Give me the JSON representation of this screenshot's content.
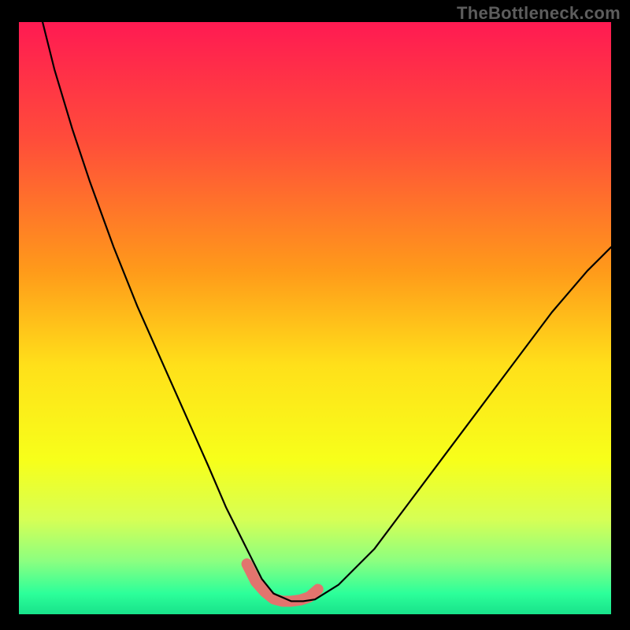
{
  "watermark": "TheBottleneck.com",
  "chart_data": {
    "type": "line",
    "title": "",
    "xlabel": "",
    "ylabel": "",
    "xlim": [
      0,
      100
    ],
    "ylim": [
      0,
      100
    ],
    "gradient_stops": [
      {
        "offset": 0.0,
        "color": "#ff1a52"
      },
      {
        "offset": 0.2,
        "color": "#ff4d3a"
      },
      {
        "offset": 0.42,
        "color": "#ff9a1a"
      },
      {
        "offset": 0.58,
        "color": "#ffe01a"
      },
      {
        "offset": 0.74,
        "color": "#f7ff1a"
      },
      {
        "offset": 0.84,
        "color": "#d6ff55"
      },
      {
        "offset": 0.91,
        "color": "#8cff80"
      },
      {
        "offset": 0.965,
        "color": "#2cff9a"
      },
      {
        "offset": 1.0,
        "color": "#18e28a"
      }
    ],
    "series": [
      {
        "name": "bottleneck-curve",
        "stroke": "#000000",
        "stroke_width": 2.2,
        "x": [
          4,
          6,
          9,
          12,
          16,
          20,
          24,
          28,
          32,
          35,
          37.5,
          39.5,
          41,
          43,
          46,
          48,
          50,
          54,
          60,
          66,
          72,
          78,
          84,
          90,
          96,
          100
        ],
        "y": [
          100,
          92,
          82,
          73,
          62,
          52,
          43,
          34,
          25,
          18,
          13,
          9,
          6,
          3.5,
          2.2,
          2.2,
          2.5,
          5,
          11,
          19,
          27,
          35,
          43,
          51,
          58,
          62
        ]
      }
    ],
    "highlight": {
      "name": "valley-highlight",
      "stroke": "#e2746e",
      "stroke_width": 14,
      "x": [
        38.5,
        40,
        41.5,
        43,
        44.5,
        46,
        47.5,
        49,
        50.5
      ],
      "y": [
        8.5,
        5.5,
        3.8,
        2.6,
        2.2,
        2.2,
        2.4,
        2.9,
        4.2
      ]
    }
  }
}
